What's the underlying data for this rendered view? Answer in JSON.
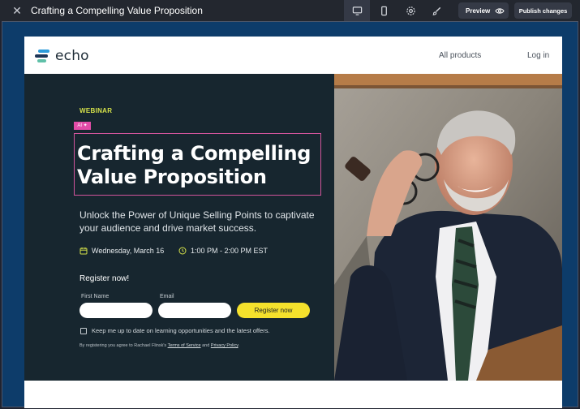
{
  "editor": {
    "close_glyph": "✕",
    "title": "Crafting a Compelling Value Proposition",
    "toolbar": [
      {
        "name": "desktop-view-icon",
        "active": true
      },
      {
        "name": "mobile-view-icon",
        "active": false
      },
      {
        "name": "settings-icon",
        "active": false
      },
      {
        "name": "brush-icon",
        "active": false
      }
    ],
    "preview_label": "Preview",
    "publish_label": "Publish changes"
  },
  "site": {
    "logo_text": "echo",
    "logo_colors": [
      "#2d9cdb",
      "#1d3557",
      "#5fc0a8"
    ],
    "nav": {
      "all_products": "All products",
      "login": "Log in"
    }
  },
  "hero": {
    "eyebrow": "WEBINAR",
    "ai_badge": "AI ✦",
    "headline": "Crafting a Compelling Value Proposition",
    "subheadline": "Unlock the Power of Unique Selling Points to captivate your audience and drive market success.",
    "date": "Wednesday, March 16",
    "time": "1:00 PM - 2:00 PM EST",
    "accent_color": "#d6e24a"
  },
  "form": {
    "title": "Register now!",
    "first_name_label": "First Name",
    "email_label": "Email",
    "first_name_value": "",
    "email_value": "",
    "submit_label": "Register now",
    "checkbox_label": "Keep me up to date on learning opportunities and the latest offers.",
    "legal_prefix": "By registering you agree to Rachael Flinsk's",
    "terms_link": "Terms of Service",
    "legal_and": "and",
    "privacy_link": "Privacy Policy",
    "legal_suffix": "."
  }
}
